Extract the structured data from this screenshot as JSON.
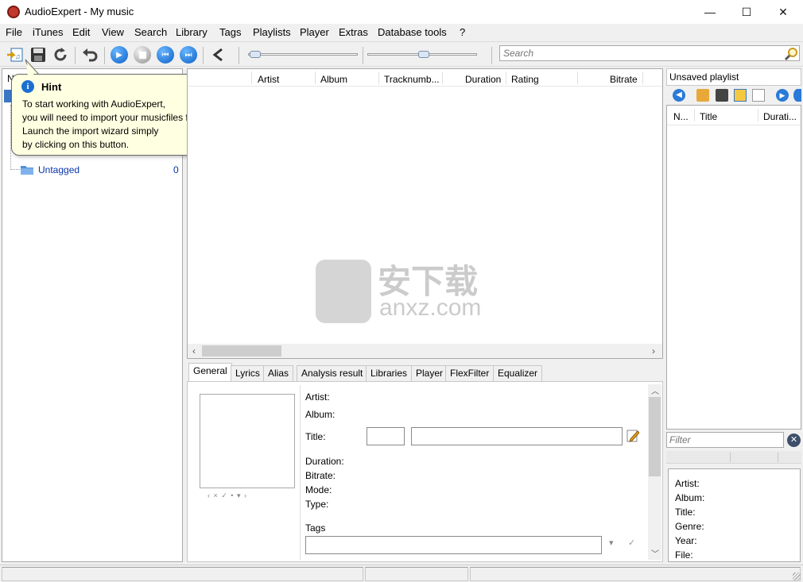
{
  "window": {
    "title": "AudioExpert - My music",
    "minimize": "—",
    "maximize": "☐",
    "close": "✕"
  },
  "menu": [
    "File",
    "iTunes",
    "Edit",
    "View",
    "Search",
    "Library",
    "Tags",
    "Playlists",
    "Player",
    "Extras",
    "Database tools",
    "?"
  ],
  "search": {
    "placeholder": "Search"
  },
  "tree": {
    "header_name": "N",
    "untagged_label": "Untagged",
    "untagged_count": "0"
  },
  "hint": {
    "title": "Hint",
    "close": "x",
    "body": "To start working with AudioExpert,\nyou will need to import your musicfiles first.\nLaunch the import wizard simply\nby clicking on this button."
  },
  "tracklist": {
    "columns": [
      "Artist",
      "Album",
      "Tracknumb...",
      "Duration",
      "Rating",
      "Bitrate"
    ]
  },
  "tabs": [
    "General",
    "Lyrics",
    "Alias",
    "Analysis result",
    "Libraries",
    "Player",
    "FlexFilter",
    "Equalizer"
  ],
  "general": {
    "artist": "Artist:",
    "album": "Album:",
    "title": "Title:",
    "duration": "Duration:",
    "bitrate": "Bitrate:",
    "mode": "Mode:",
    "type": "Type:",
    "tags": "Tags",
    "artnav": "‹  ×  ✓  •  ▾  ›"
  },
  "playlist": {
    "title": "Unsaved playlist",
    "columns": [
      "N...",
      "Title",
      "Durati..."
    ],
    "filter_placeholder": "Filter"
  },
  "info": {
    "artist": "Artist:",
    "album": "Album:",
    "title": "Title:",
    "genre": "Genre:",
    "year": "Year:",
    "file": "File:"
  },
  "watermark": {
    "line1": "安下载",
    "line2": "anxz.com"
  }
}
